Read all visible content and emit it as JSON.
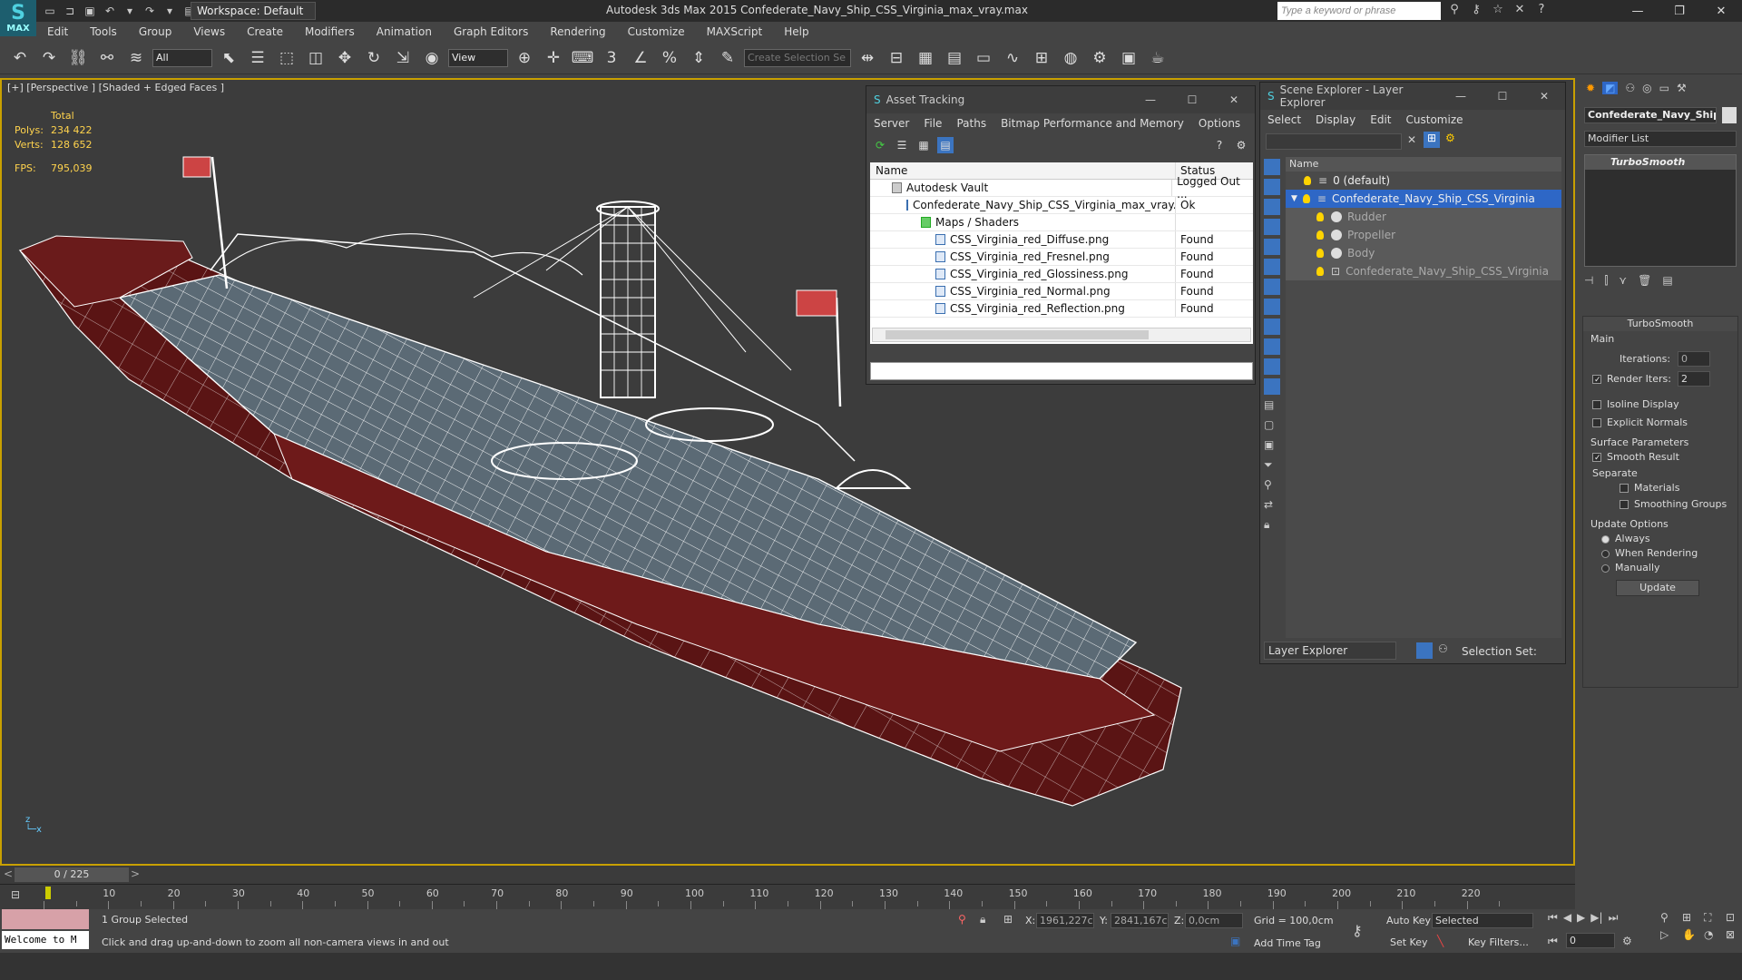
{
  "app": {
    "logo_text": "MAX",
    "workspace": "Workspace: Default",
    "title": "Autodesk 3ds Max  2015     Confederate_Navy_Ship_CSS_Virginia_max_vray.max",
    "search_placeholder": "Type a keyword or phrase"
  },
  "menu": [
    "Edit",
    "Tools",
    "Group",
    "Views",
    "Create",
    "Modifiers",
    "Animation",
    "Graph Editors",
    "Rendering",
    "Customize",
    "MAXScript",
    "Help"
  ],
  "toolbar": {
    "selection_filter": "All",
    "ref_coord": "View",
    "named_selection_placeholder": "Create Selection Se"
  },
  "viewport": {
    "label": "[+] [Perspective ] [Shaded + Edged Faces ]",
    "stats_header": "Total",
    "polys_label": "Polys:",
    "polys_value": "234 422",
    "verts_label": "Verts:",
    "verts_value": "128 652",
    "fps_label": "FPS:",
    "fps_value": "795,039"
  },
  "asset_tracking": {
    "title": "Asset Tracking",
    "menu": [
      "Server",
      "File",
      "Paths",
      "Bitmap Performance and Memory",
      "Options"
    ],
    "col_name": "Name",
    "col_status": "Status",
    "rows": [
      {
        "name": "Autodesk Vault",
        "status": "Logged Out ...",
        "indent": 1
      },
      {
        "name": "Confederate_Navy_Ship_CSS_Virginia_max_vray.max",
        "status": "Ok",
        "indent": 2
      },
      {
        "name": "Maps / Shaders",
        "status": "",
        "indent": 3
      },
      {
        "name": "CSS_Virginia_red_Diffuse.png",
        "status": "Found",
        "indent": 4
      },
      {
        "name": "CSS_Virginia_red_Fresnel.png",
        "status": "Found",
        "indent": 4
      },
      {
        "name": "CSS_Virginia_red_Glossiness.png",
        "status": "Found",
        "indent": 4
      },
      {
        "name": "CSS_Virginia_red_Normal.png",
        "status": "Found",
        "indent": 4
      },
      {
        "name": "CSS_Virginia_red_Reflection.png",
        "status": "Found",
        "indent": 4
      }
    ]
  },
  "scene_explorer": {
    "title": "Scene Explorer - Layer Explorer",
    "menu": [
      "Select",
      "Display",
      "Edit",
      "Customize"
    ],
    "col_name": "Name",
    "rows": [
      {
        "name": "0 (default)",
        "level": 0,
        "selected": false,
        "dim": false
      },
      {
        "name": "Confederate_Navy_Ship_CSS_Virginia",
        "level": 0,
        "selected": true,
        "dim": false
      },
      {
        "name": "Rudder",
        "level": 1,
        "selected": false,
        "dim": true
      },
      {
        "name": "Propeller",
        "level": 1,
        "selected": false,
        "dim": true
      },
      {
        "name": "Body",
        "level": 1,
        "selected": false,
        "dim": true
      },
      {
        "name": "Confederate_Navy_Ship_CSS_Virginia",
        "level": 1,
        "selected": false,
        "dim": true
      }
    ],
    "footer_select": "Layer Explorer",
    "selection_set_label": "Selection Set:"
  },
  "command_panel": {
    "object_name": "Confederate_Navy_Ship_",
    "modifier_list": "Modifier List",
    "stack_item": "TurboSmooth",
    "rollout_title": "TurboSmooth",
    "main_label": "Main",
    "iterations_label": "Iterations:",
    "iterations_value": "0",
    "render_iters_label": "Render Iters:",
    "render_iters_value": "2",
    "isoline": "Isoline Display",
    "explicit": "Explicit Normals",
    "surface_label": "Surface Parameters",
    "smooth_result": "Smooth Result",
    "separate_label": "Separate",
    "materials": "Materials",
    "smoothing_groups": "Smoothing Groups",
    "update_label": "Update Options",
    "always": "Always",
    "when_rendering": "When Rendering",
    "manually": "Manually",
    "update_button": "Update"
  },
  "timeline": {
    "frame": "0 / 225",
    "ticks": [
      "10",
      "20",
      "30",
      "40",
      "50",
      "60",
      "70",
      "80",
      "90",
      "100",
      "110",
      "120",
      "130",
      "140",
      "150",
      "160",
      "170",
      "180",
      "190",
      "200",
      "210",
      "220"
    ]
  },
  "status": {
    "welcome": "Welcome to M",
    "selected": "1 Group Selected",
    "hint": "Click and drag up-and-down to zoom all non-camera views in and out",
    "x_label": "X:",
    "x_value": "1961,227c",
    "y_label": "Y:",
    "y_value": "2841,167c",
    "z_label": "Z:",
    "z_value": "0,0cm",
    "grid": "Grid = 100,0cm",
    "add_time_tag": "Add Time Tag",
    "auto_key": "Auto Key",
    "set_key": "Set Key",
    "key_mode": "Selected",
    "key_filters": "Key Filters...",
    "frame_value": "0"
  }
}
